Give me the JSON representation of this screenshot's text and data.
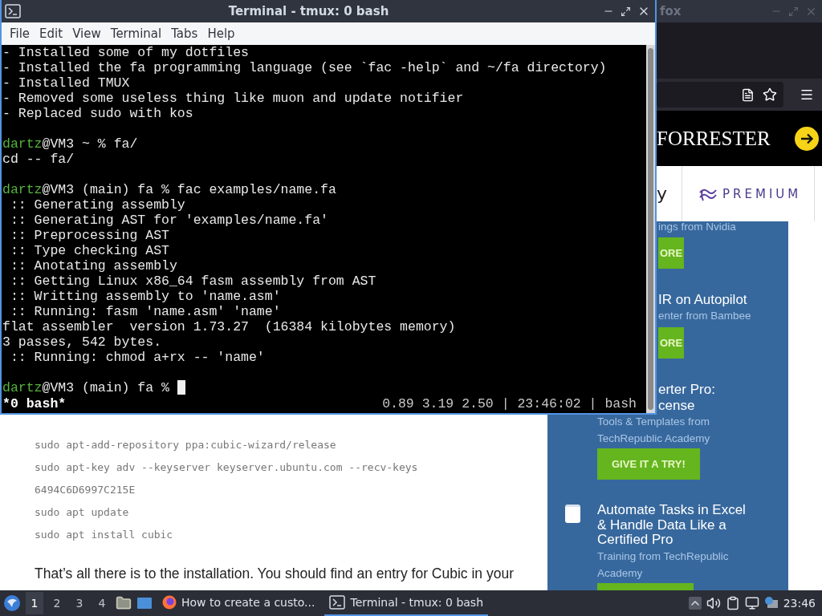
{
  "browser": {
    "title": "fox",
    "banner": {
      "brand": "FORRESTER"
    },
    "partner_strip": {
      "item_1": "y",
      "premium": "PREMIUM"
    },
    "article": {
      "code_lines": [
        "sudo apt-add-repository ppa:cubic-wizard/release",
        "sudo apt-key adv --keyserver keyserver.ubuntu.com --recv-keys",
        "6494C6D6997C215E",
        "sudo apt update",
        "sudo apt install cubic"
      ],
      "paragraph": "That’s all there is to the installation. You should find an entry for Cubic in your"
    },
    "sidebar": {
      "items": [
        {
          "meta": "ings from Nvidia",
          "button": "ORE"
        },
        {
          "title": "IR on Autopilot",
          "meta": "enter from Bambee",
          "button": "ORE"
        },
        {
          "title": "erter Pro: cense",
          "meta": "Tools & Templates from TechRepublic Academy",
          "button": "GIVE IT A TRY!"
        },
        {
          "title": "Automate Tasks in Excel & Handle Data Like a Certified Pro",
          "meta": "Training from TechRepublic Academy"
        }
      ]
    }
  },
  "terminal": {
    "title": "Terminal - tmux: 0 bash",
    "menu": [
      "File",
      "Edit",
      "View",
      "Terminal",
      "Tabs",
      "Help"
    ],
    "lines": [
      {
        "kind": "text",
        "text": "- Installed some of my dotfiles"
      },
      {
        "kind": "text",
        "text": "- Installed the fa programming language (see `fac -help` and ~/fa directory)"
      },
      {
        "kind": "text",
        "text": "- Installed TMUX"
      },
      {
        "kind": "text",
        "text": "- Removed some useless thing like muon and update notifier"
      },
      {
        "kind": "text",
        "text": "- Replaced sudo with kos"
      },
      {
        "kind": "blank"
      },
      {
        "kind": "prompt",
        "user": "dartz",
        "text": "@VM3 ~ % fa/"
      },
      {
        "kind": "text",
        "text": "cd -- fa/"
      },
      {
        "kind": "blank"
      },
      {
        "kind": "prompt",
        "user": "dartz",
        "text": "@VM3 (main) fa % fac examples/name.fa"
      },
      {
        "kind": "text",
        "text": " :: Generating assembly"
      },
      {
        "kind": "text",
        "text": " :: Generating AST for 'examples/name.fa'"
      },
      {
        "kind": "text",
        "text": " :: Preprocessing AST"
      },
      {
        "kind": "text",
        "text": " :: Type checking AST"
      },
      {
        "kind": "text",
        "text": " :: Anotating assembly"
      },
      {
        "kind": "text",
        "text": " :: Getting Linux x86_64 fasm assembly from AST"
      },
      {
        "kind": "text",
        "text": " :: Writting assembly to 'name.asm'"
      },
      {
        "kind": "text",
        "text": " :: Running: fasm 'name.asm' 'name'"
      },
      {
        "kind": "text",
        "text": "flat assembler  version 1.73.27  (16384 kilobytes memory)"
      },
      {
        "kind": "text",
        "text": "3 passes, 542 bytes."
      },
      {
        "kind": "text",
        "text": " :: Running: chmod a+rx -- 'name'"
      },
      {
        "kind": "blank"
      },
      {
        "kind": "prompt",
        "user": "dartz",
        "text": "@VM3 (main) fa %",
        "cursor": true
      }
    ],
    "status": {
      "left": "*0 bash*",
      "right": "0.89 3.19 2.50 | 23:46:02 | bash"
    }
  },
  "taskbar": {
    "workspaces": [
      {
        "label": "1",
        "selected": true
      },
      {
        "label": "2",
        "selected": false
      },
      {
        "label": "3",
        "selected": false
      },
      {
        "label": "4",
        "selected": false
      }
    ],
    "tasks": [
      {
        "kind": "browser",
        "label": "How to create a custo...",
        "selected": false
      },
      {
        "kind": "terminal",
        "label": "Terminal - tmux: 0 bash",
        "selected": true
      }
    ],
    "clock": "23:46"
  }
}
